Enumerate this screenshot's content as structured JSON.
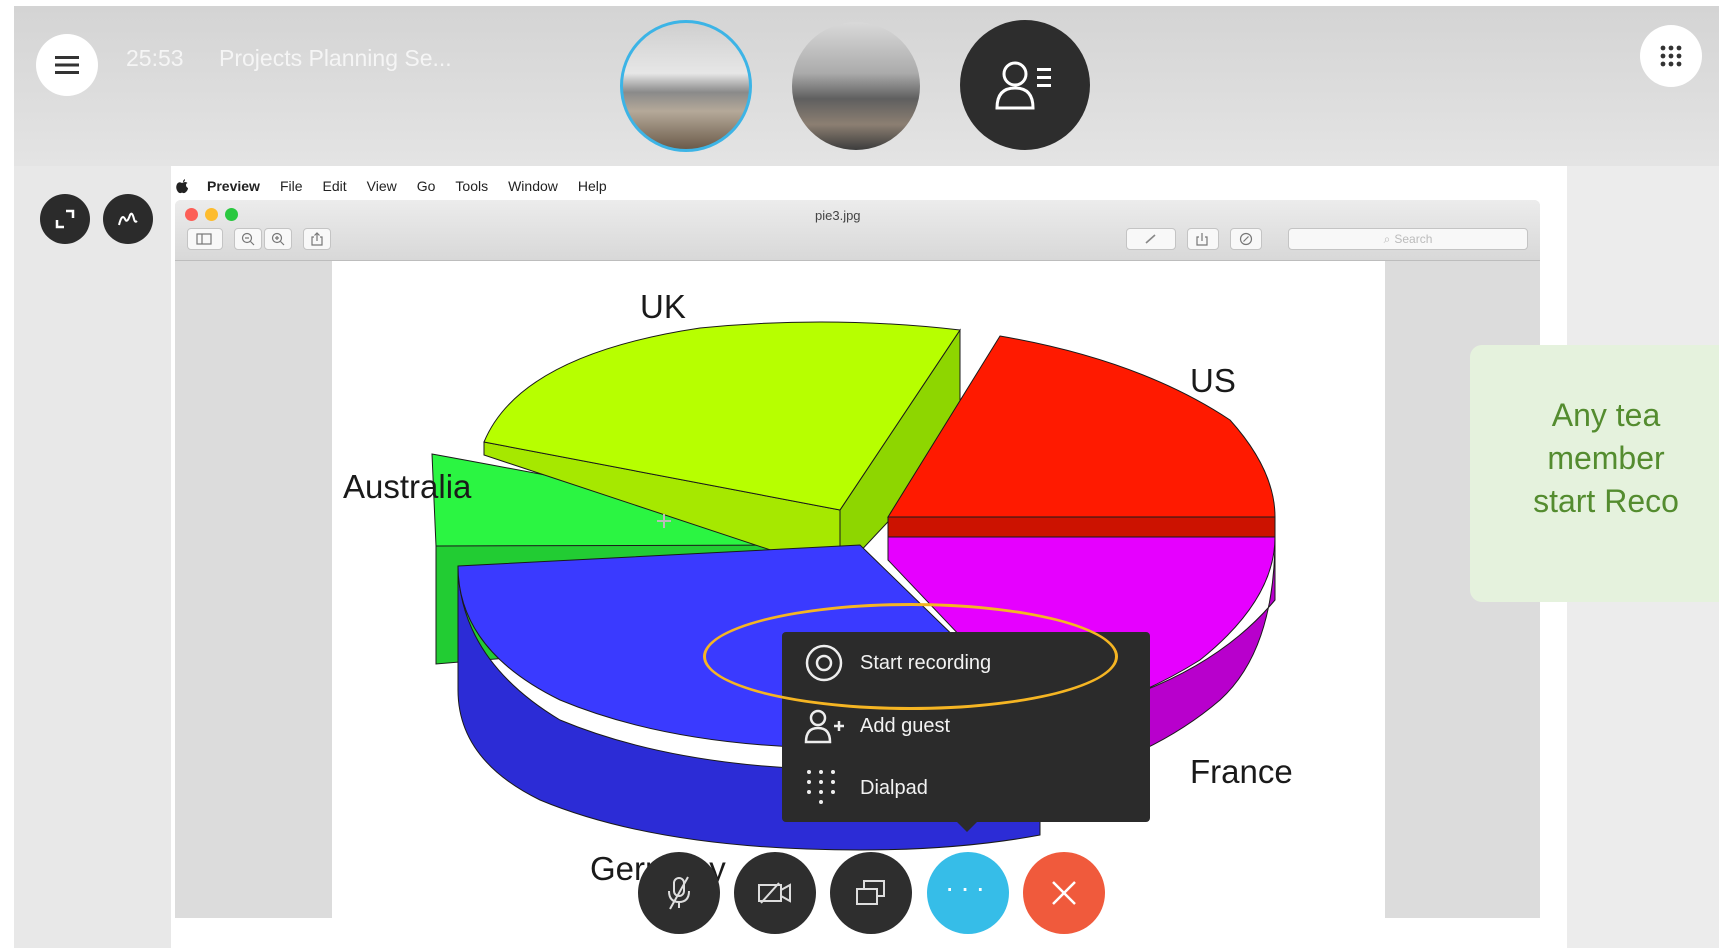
{
  "meeting": {
    "timer": "25:53",
    "title": "Projects Planning Se..."
  },
  "icons": {
    "menu": "hamburger-icon",
    "apps": "dialpad-grid-icon",
    "roster": "participants-list-icon",
    "expand": "expand-icon",
    "annotate": "pen-icon"
  },
  "mac": {
    "menus": [
      "Preview",
      "File",
      "Edit",
      "View",
      "Go",
      "Tools",
      "Window",
      "Help"
    ],
    "doc_title": "pie3.jpg",
    "search_placeholder": "Search"
  },
  "chart_data": {
    "type": "pie",
    "categories": [
      "UK",
      "US",
      "France",
      "Germany",
      "Australia"
    ],
    "colors": [
      "#b7ff00",
      "#ff1a00",
      "#e600ff",
      "#3a3aff",
      "#2bf542"
    ],
    "exploded": true,
    "style": "3d"
  },
  "callout": {
    "text": "Any tea\nmember\nstart Reco"
  },
  "popup_menu": {
    "items": [
      {
        "label": "Start recording",
        "icon": "record-icon"
      },
      {
        "label": "Add guest",
        "icon": "add-guest-icon"
      },
      {
        "label": "Dialpad",
        "icon": "dialpad-icon"
      }
    ]
  },
  "controls": {
    "mute": "mic-off-icon",
    "video": "camera-off-icon",
    "share": "screen-share-icon",
    "more": "more-icon",
    "end": "end-call-icon",
    "colors": {
      "more": "#36bde8",
      "end": "#f05a3c"
    }
  }
}
